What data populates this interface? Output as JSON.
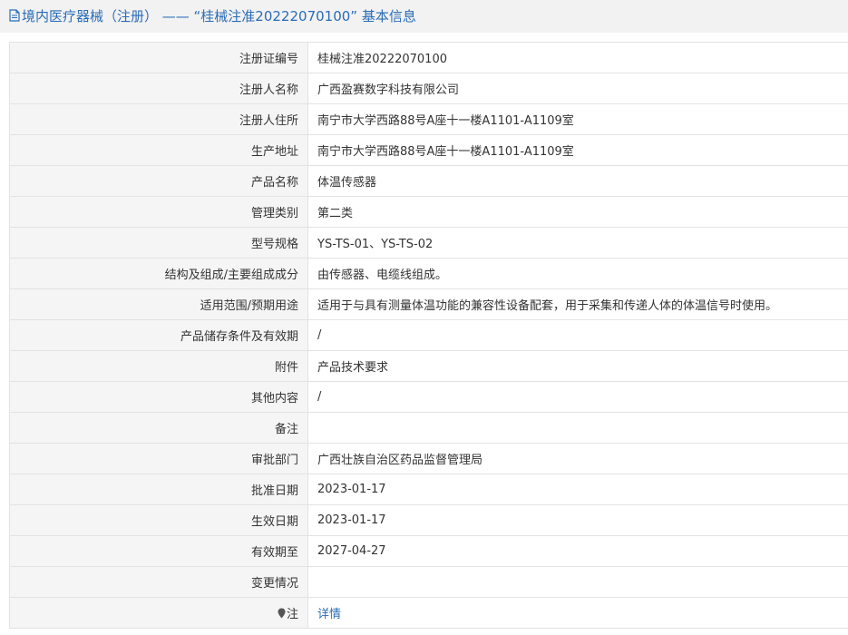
{
  "header": {
    "title": "境内医疗器械（注册） —— “桂械注准20222070100” 基本信息"
  },
  "rows": [
    {
      "label": "注册证编号",
      "value": "桂械注准20222070100"
    },
    {
      "label": "注册人名称",
      "value": "广西盈赛数字科技有限公司"
    },
    {
      "label": "注册人住所",
      "value": "南宁市大学西路88号A座十一楼A1101-A1109室"
    },
    {
      "label": "生产地址",
      "value": "南宁市大学西路88号A座十一楼A1101-A1109室"
    },
    {
      "label": "产品名称",
      "value": "体温传感器"
    },
    {
      "label": "管理类别",
      "value": "第二类"
    },
    {
      "label": "型号规格",
      "value": "YS-TS-01、YS-TS-02"
    },
    {
      "label": "结构及组成/主要组成成分",
      "value": "由传感器、电缆线组成。"
    },
    {
      "label": "适用范围/预期用途",
      "value": "适用于与具有测量体温功能的兼容性设备配套，用于采集和传递人体的体温信号时使用。"
    },
    {
      "label": "产品储存条件及有效期",
      "value": "/"
    },
    {
      "label": "附件",
      "value": "产品技术要求"
    },
    {
      "label": "其他内容",
      "value": "/"
    },
    {
      "label": "备注",
      "value": ""
    },
    {
      "label": "审批部门",
      "value": "广西壮族自治区药品监督管理局"
    },
    {
      "label": "批准日期",
      "value": "2023-01-17"
    },
    {
      "label": "生效日期",
      "value": "2023-01-17"
    },
    {
      "label": "有效期至",
      "value": "2027-04-27"
    },
    {
      "label": "变更情况",
      "value": ""
    }
  ],
  "note": {
    "label": "注",
    "icon": "pin-icon",
    "link_text": "详情"
  },
  "colors": {
    "accent": "#2a6cb7",
    "label_bg": "#f5f5f5",
    "border": "#e3e3e3"
  }
}
